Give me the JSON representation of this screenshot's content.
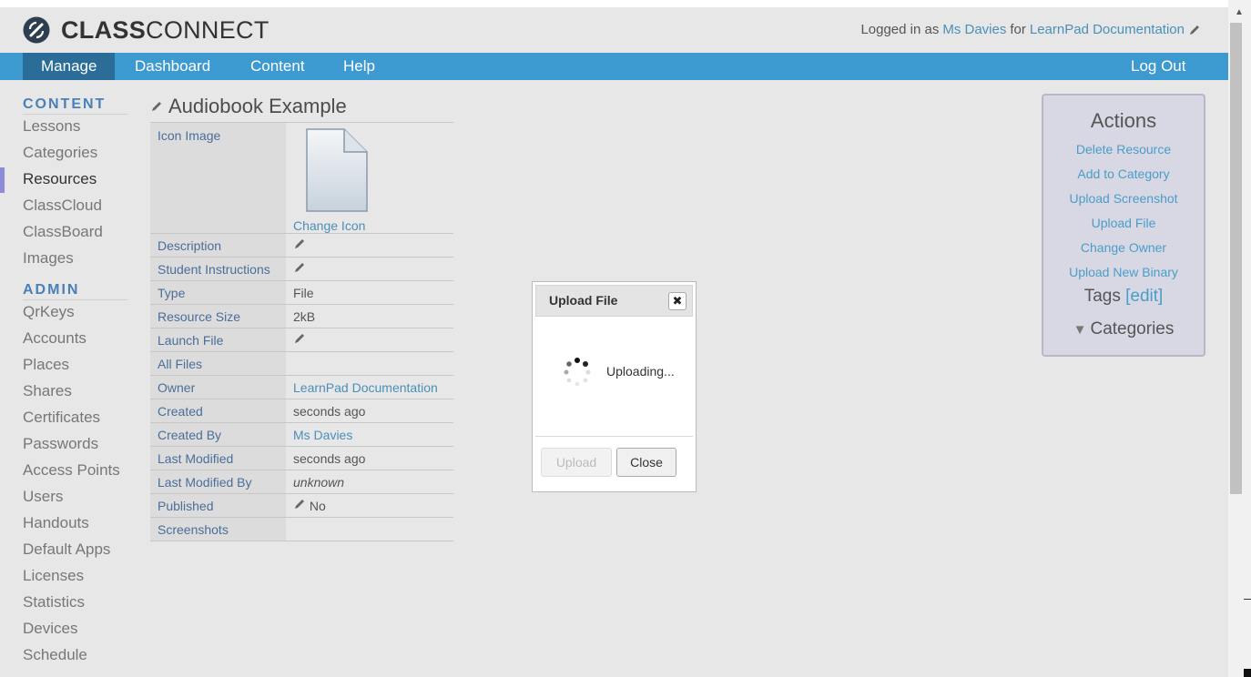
{
  "header": {
    "brand_bold": "CLASS",
    "brand_light": "CONNECT",
    "logged_in_prefix": "Logged in as",
    "user": "Ms Davies",
    "for_word": "for",
    "org": "LearnPad Documentation"
  },
  "nav": {
    "manage": "Manage",
    "dashboard": "Dashboard",
    "content": "Content",
    "help": "Help",
    "logout": "Log Out"
  },
  "sidebar": {
    "content_heading": "CONTENT",
    "content_items": [
      "Lessons",
      "Categories",
      "Resources",
      "ClassCloud",
      "ClassBoard",
      "Images"
    ],
    "admin_heading": "ADMIN",
    "admin_items": [
      "QrKeys",
      "Accounts",
      "Places",
      "Shares",
      "Certificates",
      "Passwords",
      "Access Points",
      "Users",
      "Handouts",
      "Default Apps",
      "Licenses",
      "Statistics",
      "Devices",
      "Schedule"
    ]
  },
  "main": {
    "title": "Audiobook Example",
    "change_icon": "Change Icon",
    "rows": [
      {
        "key": "Icon Image",
        "value": ""
      },
      {
        "key": "Description",
        "value": ""
      },
      {
        "key": "Student Instructions",
        "value": ""
      },
      {
        "key": "Type",
        "value": "File"
      },
      {
        "key": "Resource Size",
        "value": "2kB"
      },
      {
        "key": "Launch File",
        "value": ""
      },
      {
        "key": "All Files",
        "value": ""
      },
      {
        "key": "Owner",
        "value": "LearnPad Documentation"
      },
      {
        "key": "Created",
        "value": "seconds ago"
      },
      {
        "key": "Created By",
        "value": "Ms Davies"
      },
      {
        "key": "Last Modified",
        "value": "seconds ago"
      },
      {
        "key": "Last Modified By",
        "value": "unknown"
      },
      {
        "key": "Published",
        "value": "No"
      },
      {
        "key": "Screenshots",
        "value": ""
      }
    ]
  },
  "actions": {
    "heading": "Actions",
    "items": [
      "Delete Resource",
      "Add to Category",
      "Upload Screenshot",
      "Upload File",
      "Change Owner",
      "Upload New Binary"
    ],
    "tags_label": "Tags",
    "tags_edit": "[edit]",
    "categories_label": "Categories"
  },
  "modal": {
    "title": "Upload File",
    "status": "Uploading...",
    "upload_btn": "Upload",
    "close_btn": "Close"
  }
}
